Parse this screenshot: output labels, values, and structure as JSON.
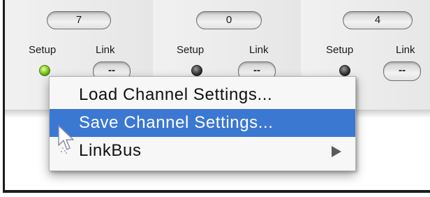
{
  "channels": [
    {
      "number": "7",
      "setup_label": "Setup",
      "link_label": "Link",
      "link_value": "--",
      "setup_led": "on"
    },
    {
      "number": "0",
      "setup_label": "Setup",
      "link_label": "Link",
      "link_value": "--",
      "setup_led": "off"
    },
    {
      "number": "4",
      "setup_label": "Setup",
      "link_label": "Link",
      "link_value": "--",
      "setup_led": "off"
    }
  ],
  "context_menu": {
    "items": [
      {
        "label": "Load Channel Settings...",
        "highlighted": false,
        "has_submenu": false
      },
      {
        "label": "Save Channel Settings...",
        "highlighted": true,
        "has_submenu": false
      },
      {
        "label": "LinkBus",
        "highlighted": false,
        "has_submenu": true
      }
    ]
  },
  "colors": {
    "highlight": "#3b78d2",
    "led_on": "#8ccf2a",
    "led_off": "#3a3a3a"
  },
  "icons": {
    "cursor": "arrow-pointer-icon",
    "submenu": "triangle-right-icon",
    "setup_led": "led-indicator-icon"
  }
}
